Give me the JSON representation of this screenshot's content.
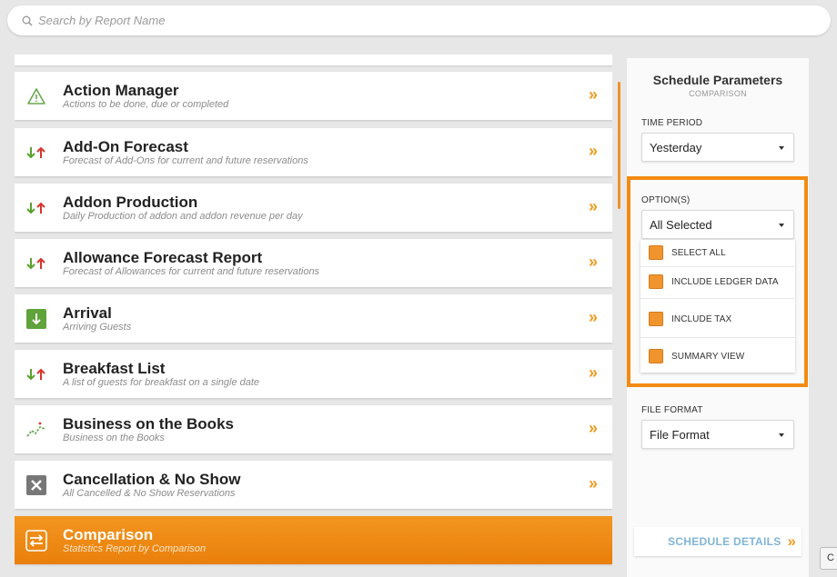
{
  "search": {
    "placeholder": "Search by Report Name"
  },
  "reports": [
    {
      "title": "Action Manager",
      "desc": "Actions to be done, due or completed",
      "icon": "warning-triangle-icon"
    },
    {
      "title": "Add-On Forecast",
      "desc": "Forecast of Add-Ons for current and future reservations",
      "icon": "up-down-arrows-icon"
    },
    {
      "title": "Addon Production",
      "desc": "Daily Production of addon and addon revenue per day",
      "icon": "up-down-arrows-icon"
    },
    {
      "title": "Allowance Forecast Report",
      "desc": "Forecast of Allowances for current and future reservations",
      "icon": "up-down-arrows-icon"
    },
    {
      "title": "Arrival",
      "desc": "Arriving Guests",
      "icon": "arrival-down-arrow-icon"
    },
    {
      "title": "Breakfast List",
      "desc": "A list of guests for breakfast on a single date",
      "icon": "up-down-arrows-icon"
    },
    {
      "title": "Business on the Books",
      "desc": "Business on the Books",
      "icon": "trend-chart-icon"
    },
    {
      "title": "Cancellation & No Show",
      "desc": "All Cancelled & No Show Reservations",
      "icon": "cancel-x-icon"
    },
    {
      "title": "Comparison",
      "desc": "Statistics Report by Comparison",
      "icon": "swap-arrows-icon",
      "active": true
    }
  ],
  "chevron": "»",
  "panel": {
    "title": "Schedule Parameters",
    "subtitle": "COMPARISON",
    "time_period_label": "TIME PERIOD",
    "time_period_value": "Yesterday",
    "options_label": "OPTION(S)",
    "options_value": "All Selected",
    "options": [
      "SELECT ALL",
      "INCLUDE LEDGER DATA",
      "INCLUDE TAX",
      "SUMMARY VIEW"
    ],
    "file_format_label": "FILE FORMAT",
    "file_format_value": "File Format",
    "schedule_button": "SCHEDULE DETAILS"
  },
  "edge_button": "C",
  "colors": {
    "accent": "#f39a1e",
    "highlight_border": "#f38b12",
    "link_blue": "#7fb5d8",
    "up_arrow": "#d9342b",
    "down_arrow": "#5aa02c"
  }
}
